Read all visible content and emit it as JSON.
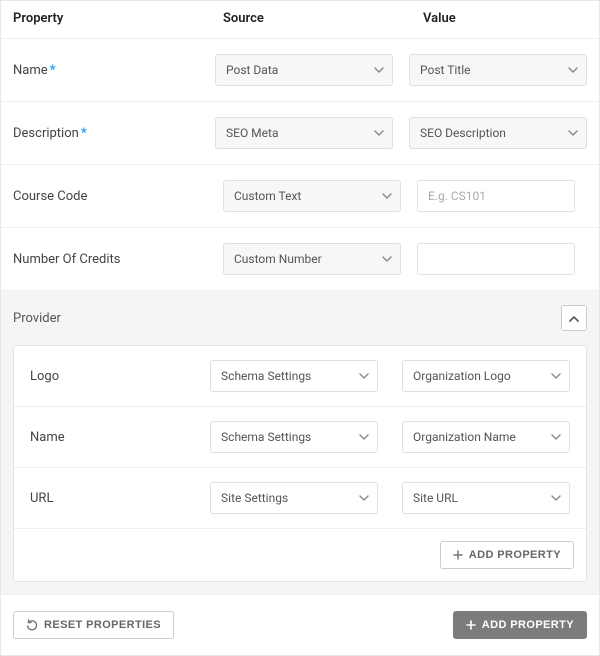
{
  "header": {
    "property": "Property",
    "source": "Source",
    "value": "Value"
  },
  "rows": [
    {
      "label": "Name",
      "required": true,
      "source": "Post Data",
      "value_type": "select",
      "value": "Post Title"
    },
    {
      "label": "Description",
      "required": true,
      "source": "SEO Meta",
      "value_type": "select",
      "value": "SEO Description"
    },
    {
      "label": "Course Code",
      "required": false,
      "source": "Custom Text",
      "value_type": "text",
      "placeholder": "E.g. CS101",
      "value": ""
    },
    {
      "label": "Number Of Credits",
      "required": false,
      "source": "Custom Number",
      "value_type": "text",
      "placeholder": "",
      "value": ""
    }
  ],
  "group": {
    "label": "Provider",
    "rows": [
      {
        "label": "Logo",
        "source": "Schema Settings",
        "value": "Organization Logo"
      },
      {
        "label": "Name",
        "source": "Schema Settings",
        "value": "Organization Name"
      },
      {
        "label": "URL",
        "source": "Site Settings",
        "value": "Site URL"
      }
    ],
    "add_label": "Add Property"
  },
  "footer": {
    "reset": "Reset Properties",
    "add": "Add Property"
  },
  "required_mark": "*"
}
